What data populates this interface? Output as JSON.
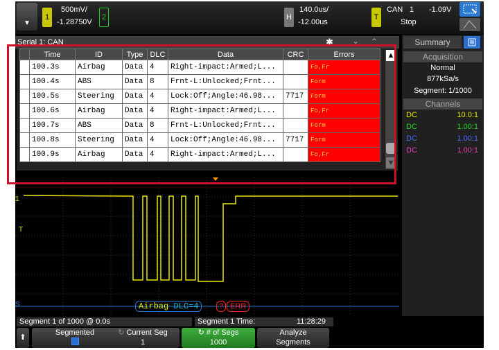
{
  "topbar": {
    "ch1_label": "1",
    "ch1_scale": "500mV/",
    "ch1_offset": "-1.28750V",
    "ch2_label": "2",
    "horiz_label": "H",
    "time_div": "140.0us/",
    "time_delay": "-12.00us",
    "trigger_label": "T",
    "trigger_source": "CAN",
    "trigger_channel": "1",
    "trigger_level": "-1.09V",
    "run_state": "Stop"
  },
  "serial_panel": {
    "title": "Serial 1: CAN",
    "columns": [
      "Time",
      "ID",
      "Type",
      "DLC",
      "Data",
      "CRC",
      "Errors"
    ],
    "rows": [
      {
        "time": "100.3s",
        "id": "Airbag",
        "type": "Data",
        "dlc": "4",
        "data": "Right-impact:Armed;L...",
        "crc": "",
        "errors": "Fo,Fr"
      },
      {
        "time": "100.4s",
        "id": "ABS",
        "type": "Data",
        "dlc": "8",
        "data": "Frnt-L:Unlocked;Frnt...",
        "crc": "",
        "errors": "Form"
      },
      {
        "time": "100.5s",
        "id": "Steering",
        "type": "Data",
        "dlc": "4",
        "data": "Lock:Off;Angle:46.98...",
        "crc": "7717",
        "errors": "Form"
      },
      {
        "time": "100.6s",
        "id": "Airbag",
        "type": "Data",
        "dlc": "4",
        "data": "Right-impact:Armed;L...",
        "crc": "",
        "errors": "Fo,Fr"
      },
      {
        "time": "100.7s",
        "id": "ABS",
        "type": "Data",
        "dlc": "8",
        "data": "Frnt-L:Unlocked;Frnt...",
        "crc": "",
        "errors": "Form"
      },
      {
        "time": "100.8s",
        "id": "Steering",
        "type": "Data",
        "dlc": "4",
        "data": "Lock:Off;Angle:46.98...",
        "crc": "7717",
        "errors": "Form"
      },
      {
        "time": "100.9s",
        "id": "Airbag",
        "type": "Data",
        "dlc": "4",
        "data": "Right-impact:Armed;L...",
        "crc": "",
        "errors": "Fo,Fr"
      }
    ]
  },
  "waveform": {
    "ch1_marker": "1",
    "trigger_marker": "T",
    "serial_marker": "S",
    "decode_id": "Airbag",
    "decode_dlc": "DLC=4",
    "decode_q": "?",
    "decode_err": "ERR"
  },
  "right_panel": {
    "tab_summary": "Summary",
    "acq_header": "Acquisition",
    "acq_mode": "Normal",
    "sample_rate": "877kSa/s",
    "segment": "Segment: 1/1000",
    "channels_header": "Channels",
    "channels": [
      {
        "coupling": "DC",
        "probe": "10.0:1",
        "color": "#e8e800"
      },
      {
        "coupling": "DC",
        "probe": "1.00:1",
        "color": "#22dd22"
      },
      {
        "coupling": "DC",
        "probe": "1.00:1",
        "color": "#4a6cff"
      },
      {
        "coupling": "DC",
        "probe": "1.00:1",
        "color": "#e040b0"
      }
    ]
  },
  "status": {
    "segment_info": "Segment 1 of 1000 @ 0.0s",
    "segment_time_label": "Segment 1 Time:",
    "segment_time_value": "11:28:29"
  },
  "softkeys": {
    "segmented": "Segmented",
    "current_seg": "Current Seg",
    "current_seg_value": "1",
    "num_segs": "# of Segs",
    "num_segs_value": "1000",
    "analyze_line1": "Analyze",
    "analyze_line2": "Segments"
  },
  "colors": {
    "ch1": "#e8e800",
    "ch2": "#22cc22",
    "error_cell": "#ff0000",
    "highlight_frame": "#d0102a"
  }
}
